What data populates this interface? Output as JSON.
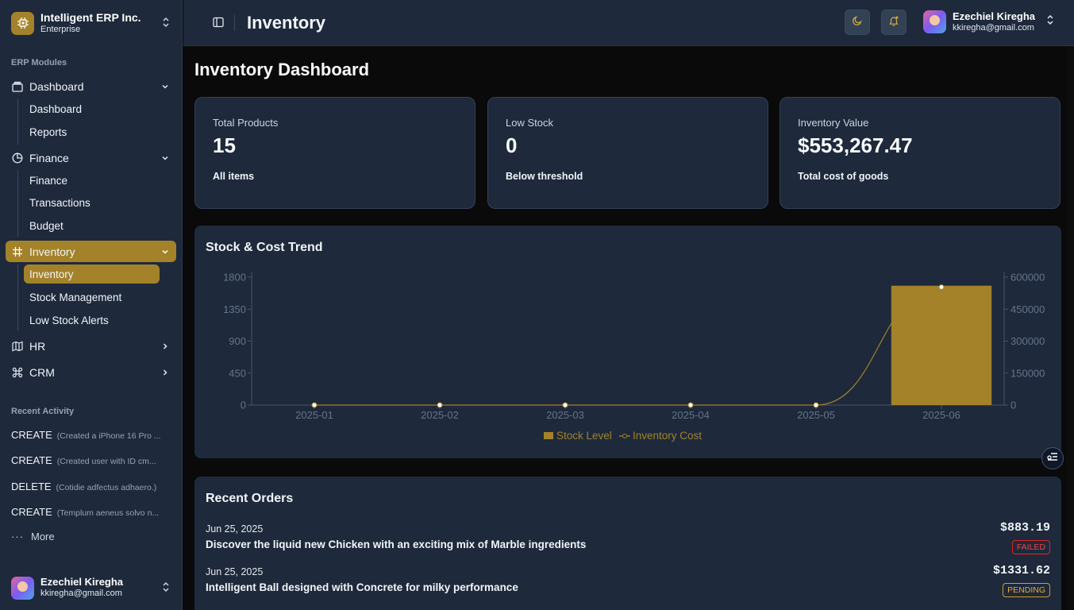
{
  "org": {
    "name": "Intelligent ERP Inc.",
    "plan": "Enterprise"
  },
  "sidebar": {
    "section_label": "ERP Modules",
    "groups": [
      {
        "label": "Dashboard",
        "icon": "dashboard-icon",
        "items": [
          "Dashboard",
          "Reports"
        ]
      },
      {
        "label": "Finance",
        "icon": "pie-chart-icon",
        "items": [
          "Finance",
          "Transactions",
          "Budget"
        ]
      },
      {
        "label": "Inventory",
        "icon": "hash-icon",
        "items": [
          "Inventory",
          "Stock Management",
          "Low Stock Alerts"
        ]
      },
      {
        "label": "HR",
        "icon": "map-icon",
        "items": []
      },
      {
        "label": "CRM",
        "icon": "command-icon",
        "items": []
      }
    ],
    "recent_label": "Recent Activity",
    "activity": [
      {
        "type": "CREATE",
        "desc": "(Created a iPhone 16 Pro ..."
      },
      {
        "type": "CREATE",
        "desc": "(Created user with ID cm..."
      },
      {
        "type": "DELETE",
        "desc": "(Cotidie adfectus adhaero.)"
      },
      {
        "type": "CREATE",
        "desc": "(Templum aeneus solvo n..."
      }
    ],
    "more_label": "More"
  },
  "user": {
    "name": "Ezechiel Kiregha",
    "email": "kkiregha@gmail.com"
  },
  "header": {
    "title": "Inventory"
  },
  "page": {
    "heading": "Inventory Dashboard",
    "stats": [
      {
        "label": "Total Products",
        "value": "15",
        "note": "All items"
      },
      {
        "label": "Low Stock",
        "value": "0",
        "note": "Below threshold"
      },
      {
        "label": "Inventory Value",
        "value": "$553,267.47",
        "note": "Total cost of goods"
      }
    ],
    "chart_title": "Stock & Cost Trend",
    "orders_title": "Recent Orders",
    "orders": [
      {
        "date": "Jun 25, 2025",
        "title": "Discover the liquid new Chicken with an exciting mix of Marble ingredients",
        "amount": "$883.19",
        "status": "FAILED",
        "status_color": "#dc2626"
      },
      {
        "date": "Jun 25, 2025",
        "title": "Intelligent Ball designed with Concrete for milky performance",
        "amount": "$1331.62",
        "status": "PENDING",
        "status_color": "#d59a2c"
      }
    ]
  },
  "colors": {
    "accent": "#a3822a",
    "bar": "#a3822a",
    "line": "#a3822a"
  },
  "chart_data": {
    "type": "bar",
    "categories": [
      "2025-01",
      "2025-02",
      "2025-03",
      "2025-04",
      "2025-05",
      "2025-06"
    ],
    "series": [
      {
        "name": "Stock Level",
        "type": "bar",
        "axis": "left",
        "values": [
          0,
          0,
          0,
          0,
          0,
          1680
        ]
      },
      {
        "name": "Inventory Cost",
        "type": "line",
        "axis": "right",
        "values": [
          0,
          0,
          0,
          0,
          0,
          553267.47
        ]
      }
    ],
    "y_left": {
      "ticks": [
        "0",
        "450",
        "900",
        "1350",
        "1800"
      ],
      "range": [
        0,
        1800
      ]
    },
    "y_right": {
      "ticks": [
        "0",
        "150000",
        "300000",
        "450000",
        "600000"
      ],
      "range": [
        0,
        600000
      ]
    },
    "legend_position": "bottom"
  }
}
